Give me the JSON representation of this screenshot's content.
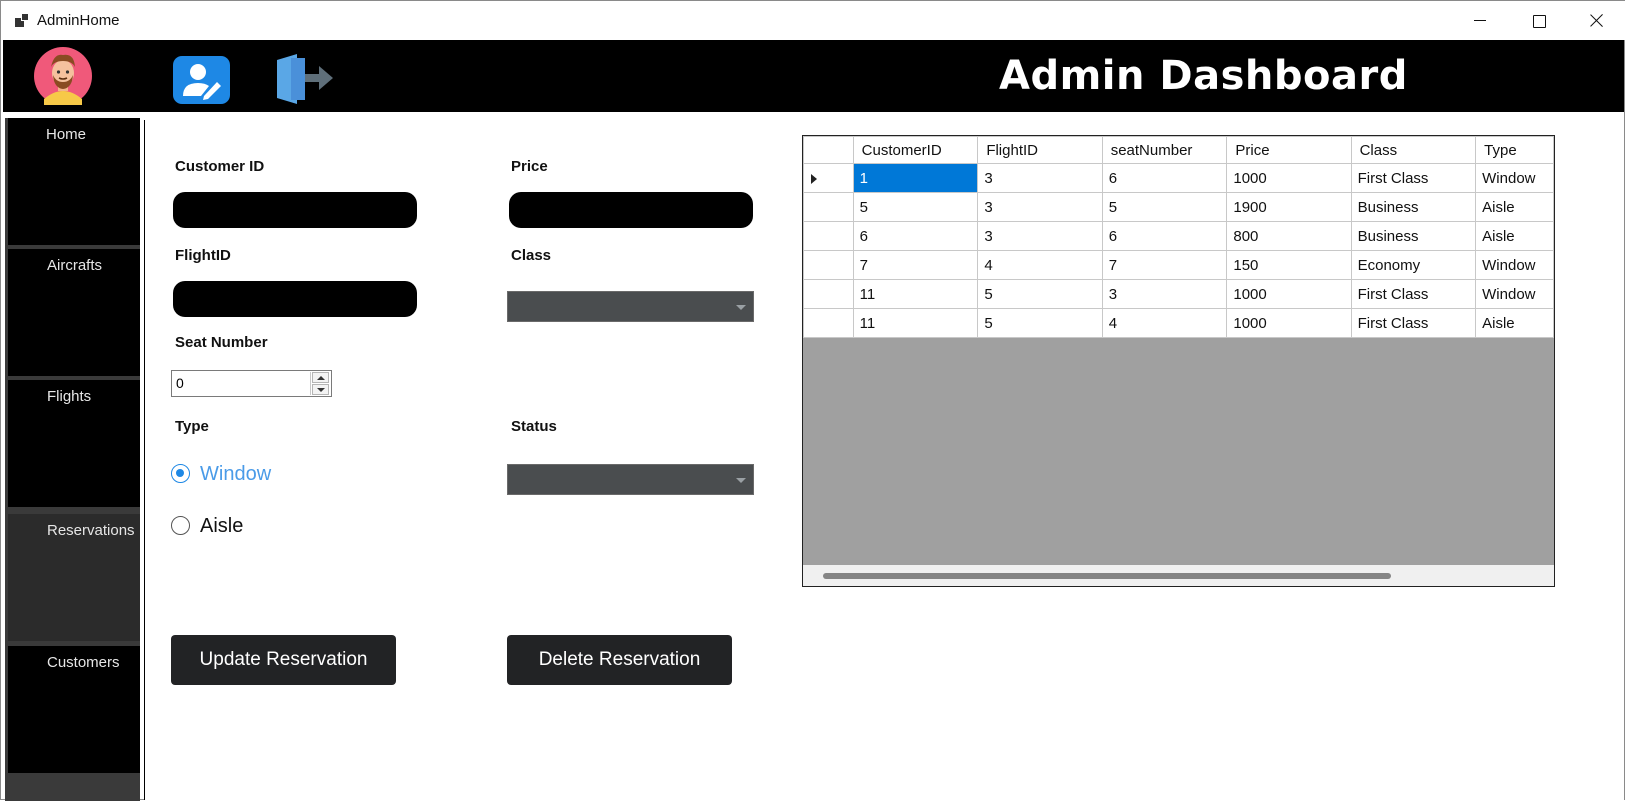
{
  "window": {
    "title": "AdminHome"
  },
  "header": {
    "title": "Admin Dashboard"
  },
  "sidebar": {
    "items": [
      {
        "label": "Home"
      },
      {
        "label": "Aircrafts"
      },
      {
        "label": "Flights"
      },
      {
        "label": "Reservations",
        "active": true
      },
      {
        "label": "Customers"
      }
    ]
  },
  "form": {
    "customer_id_label": "Customer ID",
    "customer_id_value": "",
    "price_label": "Price",
    "price_value": "",
    "flight_id_label": "FlightID",
    "flight_id_value": "",
    "class_label": "Class",
    "class_value": "",
    "seat_number_label": "Seat Number",
    "seat_number_value": "0",
    "type_label": "Type",
    "type_options": [
      {
        "label": "Window",
        "checked": true
      },
      {
        "label": "Aisle",
        "checked": false
      }
    ],
    "status_label": "Status",
    "status_value": ""
  },
  "actions": {
    "update_label": "Update Reservation",
    "delete_label": "Delete Reservation"
  },
  "grid": {
    "columns": [
      "CustomerID",
      "FlightID",
      "seatNumber",
      "Price",
      "Class",
      "Type"
    ],
    "rows": [
      [
        "1",
        "3",
        "6",
        "1000",
        "First Class",
        "Window"
      ],
      [
        "5",
        "3",
        "5",
        "1900",
        "Business",
        "Aisle"
      ],
      [
        "6",
        "3",
        "6",
        "800",
        "Business",
        "Aisle"
      ],
      [
        "7",
        "4",
        "7",
        "150",
        "Economy",
        "Window"
      ],
      [
        "11",
        "5",
        "3",
        "1000",
        "First Class",
        "Window"
      ],
      [
        "11",
        "5",
        "4",
        "1000",
        "First Class",
        "Aisle"
      ]
    ],
    "selected_row": 0
  },
  "colors": {
    "accent": "#1e88e5",
    "header_bg": "#000000",
    "selection": "#0078d7",
    "button_bg": "#222325"
  },
  "icons": [
    "app-icon",
    "avatar-icon",
    "edit-user-icon",
    "logout-icon",
    "minimize-icon",
    "maximize-icon",
    "close-icon"
  ]
}
